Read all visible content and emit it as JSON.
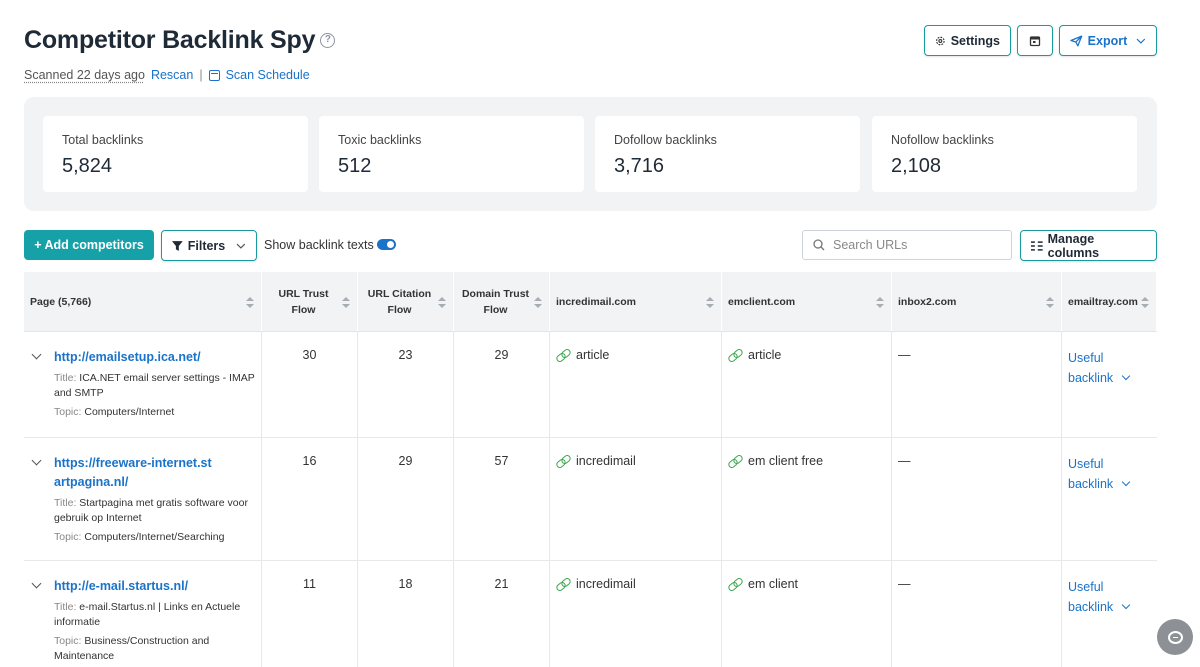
{
  "header": {
    "title": "Competitor Backlink Spy",
    "scanned": "Scanned 22 days ago",
    "rescan": "Rescan",
    "separator": "|",
    "scan_schedule": "Scan Schedule"
  },
  "actions": {
    "settings": "Settings",
    "export": "Export"
  },
  "stats": [
    {
      "label": "Total backlinks",
      "value": "5,824"
    },
    {
      "label": "Toxic backlinks",
      "value": "512"
    },
    {
      "label": "Dofollow backlinks",
      "value": "3,716"
    },
    {
      "label": "Nofollow backlinks",
      "value": "2,108"
    }
  ],
  "toolbar": {
    "add_competitors": "+ Add competitors",
    "filters": "Filters",
    "show_texts": "Show backlink texts",
    "show_texts_on": true,
    "search_placeholder": "Search URLs",
    "manage_columns": "Manage columns"
  },
  "columns": {
    "page": "Page (5,766)",
    "utf_1": "URL Trust",
    "utf_2": "Flow",
    "ucf_1": "URL Citation",
    "ucf_2": "Flow",
    "dtf_1": "Domain Trust",
    "dtf_2": "Flow",
    "c1": "incredimail.com",
    "c2": "emclient.com",
    "c3": "inbox2.com",
    "c4": "emailtray.com"
  },
  "rows": [
    {
      "url": "http://emailsetup.ica.net/",
      "title_label": "Title:",
      "title": "ICA.NET email server settings - IMAP and SMTP",
      "topic_label": "Topic:",
      "topic": "Computers/Internet",
      "utf": "30",
      "ucf": "23",
      "dtf": "29",
      "c1": "article",
      "c2": "article",
      "c3": "—",
      "c4_1": "Useful",
      "c4_2": "backlink"
    },
    {
      "url": "https://freeware-internet.startpagina.nl/",
      "title_label": "Title:",
      "title": "Startpagina met gratis software voor gebruik op Internet",
      "topic_label": "Topic:",
      "topic": "Computers/Internet/Searching",
      "utf": "16",
      "ucf": "29",
      "dtf": "57",
      "c1": "incredimail",
      "c2": "em client free",
      "c3": "—",
      "c4_1": "Useful",
      "c4_2": "backlink"
    },
    {
      "url": "http://e-mail.startus.nl/",
      "title_label": "Title:",
      "title": "e-mail.Startus.nl | Links en Actuele informatie",
      "topic_label": "Topic:",
      "topic": "Business/Construction and Maintenance",
      "utf": "11",
      "ucf": "18",
      "dtf": "21",
      "c1": "incredimail",
      "c2": "em client",
      "c3": "—",
      "c4_1": "Useful",
      "c4_2": "backlink"
    }
  ],
  "colors": {
    "accent": "#16a0a8",
    "link": "#1a73c9",
    "link_icon": "#3aa64a"
  }
}
